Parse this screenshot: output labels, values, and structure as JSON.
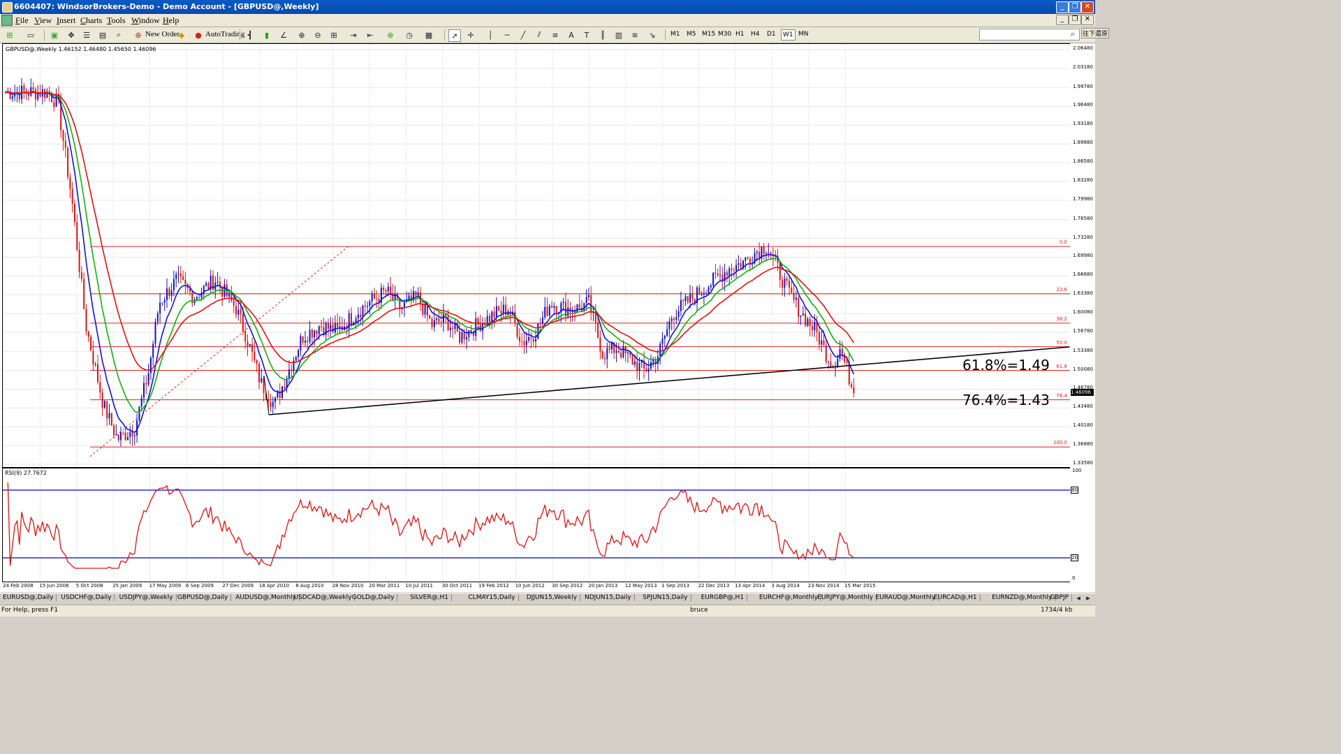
{
  "window": {
    "title": "6604407: WindsorBrokers-Demo - Demo Account - [GBPUSD@,Weekly]",
    "controls": [
      "_",
      "❐",
      "✕"
    ]
  },
  "menu": [
    "File",
    "View",
    "Insert",
    "Charts",
    "Tools",
    "Window",
    "Help"
  ],
  "toolbar": {
    "new_order": "New Order",
    "autotrading": "AutoTrading",
    "timeframes": [
      "M1",
      "M5",
      "M15",
      "M30",
      "H1",
      "H4",
      "D1",
      "W1",
      "MN"
    ],
    "active_timeframe": "W1",
    "search_button": "往下還原"
  },
  "chart": {
    "header": "GBPUSD@,Weekly  1.46152 1.46480 1.45650 1.46096",
    "current_price": "1.46096",
    "fib_labels": [
      {
        "text": "0.0",
        "price": 1.7185
      },
      {
        "text": "23.6",
        "price": 1.6355
      },
      {
        "text": "38.2",
        "price": 1.5839
      },
      {
        "text": "50.0",
        "price": 1.5425
      },
      {
        "text": "61.8",
        "price": 1.5008
      },
      {
        "text": "76.4",
        "price": 1.4492
      },
      {
        "text": "100.0",
        "price": 1.3662
      }
    ],
    "annotations": [
      "61.8%=1.49",
      "76.4%=1.43"
    ],
    "price_axis": [
      "2.06480",
      "2.03180",
      "1.99780",
      "1.96480",
      "1.93180",
      "1.89880",
      "1.86580",
      "1.83280",
      "1.79980",
      "1.76580",
      "1.73280",
      "1.69980",
      "1.66680",
      "1.63380",
      "1.60080",
      "1.56780",
      "1.53380",
      "1.50080",
      "1.46780",
      "1.43480",
      "1.40180",
      "1.36880",
      "1.33580"
    ],
    "time_axis": [
      "24 Feb 2008",
      "15 Jun 2008",
      "5 Oct 2008",
      "25 Jan 2009",
      "17 May 2009",
      "6 Sep 2009",
      "27 Dec 2009",
      "18 Apr 2010",
      "8 Aug 2010",
      "28 Nov 2010",
      "20 Mar 2011",
      "10 Jul 2011",
      "30 Oct 2011",
      "19 Feb 2012",
      "10 Jun 2012",
      "30 Sep 2012",
      "20 Jan 2013",
      "12 May 2013",
      "1 Sep 2013",
      "22 Dec 2013",
      "13 Apr 2014",
      "3 Aug 2014",
      "23 Nov 2014",
      "15 Mar 2015"
    ],
    "colors": {
      "bull": "#1010c8",
      "bear": "#e01010",
      "ma_fast": "#1010e0",
      "ma_mid": "#10b010",
      "ma_slow": "#e01010",
      "fib": "#e02020",
      "trend": "#000000"
    }
  },
  "chart_data": {
    "type": "candlestick",
    "symbol": "GBPUSD@",
    "timeframe": "Weekly",
    "last_bar": {
      "open": 1.46152,
      "high": 1.4648,
      "low": 1.4565,
      "close": 1.46096
    },
    "ylim": [
      1.3358,
      2.0648
    ],
    "approx_close_path": [
      [
        0,
        1.99
      ],
      [
        60,
        1.99
      ],
      [
        75,
        1.97
      ],
      [
        95,
        1.8
      ],
      [
        115,
        1.58
      ],
      [
        140,
        1.44
      ],
      [
        160,
        1.38
      ],
      [
        185,
        1.4
      ],
      [
        205,
        1.5
      ],
      [
        220,
        1.62
      ],
      [
        245,
        1.66
      ],
      [
        270,
        1.63
      ],
      [
        300,
        1.66
      ],
      [
        330,
        1.61
      ],
      [
        345,
        1.56
      ],
      [
        365,
        1.48
      ],
      [
        385,
        1.44
      ],
      [
        405,
        1.5
      ],
      [
        425,
        1.56
      ],
      [
        450,
        1.58
      ],
      [
        475,
        1.57
      ],
      [
        500,
        1.6
      ],
      [
        520,
        1.62
      ],
      [
        545,
        1.64
      ],
      [
        565,
        1.61
      ],
      [
        590,
        1.63
      ],
      [
        610,
        1.58
      ],
      [
        630,
        1.59
      ],
      [
        650,
        1.56
      ],
      [
        675,
        1.58
      ],
      [
        700,
        1.6
      ],
      [
        720,
        1.61
      ],
      [
        740,
        1.55
      ],
      [
        760,
        1.57
      ],
      [
        780,
        1.62
      ],
      [
        800,
        1.61
      ],
      [
        820,
        1.61
      ],
      [
        835,
        1.62
      ],
      [
        855,
        1.53
      ],
      [
        875,
        1.54
      ],
      [
        895,
        1.52
      ],
      [
        915,
        1.5
      ],
      [
        935,
        1.53
      ],
      [
        955,
        1.6
      ],
      [
        975,
        1.62
      ],
      [
        995,
        1.64
      ],
      [
        1015,
        1.66
      ],
      [
        1035,
        1.68
      ],
      [
        1055,
        1.69
      ],
      [
        1075,
        1.71
      ],
      [
        1090,
        1.72
      ],
      [
        1105,
        1.68
      ],
      [
        1120,
        1.64
      ],
      [
        1140,
        1.6
      ],
      [
        1160,
        1.57
      ],
      [
        1175,
        1.53
      ],
      [
        1185,
        1.51
      ],
      [
        1195,
        1.54
      ],
      [
        1205,
        1.5
      ],
      [
        1215,
        1.46
      ]
    ],
    "indicator": {
      "name": "RSI(9)",
      "value": "27.7672",
      "levels": [
        80,
        20
      ],
      "scale": [
        "100",
        "80",
        "20",
        "0"
      ]
    }
  },
  "symbol_tabs": [
    "EURUSD@,Daily",
    "USDCHF@,Daily",
    "USDJPY@,Weekly",
    "GBPUSD@,Daily",
    "AUDUSD@,Monthly",
    "USDCAD@,Weekly",
    "GOLD@,Daily",
    "SILVER@,H1",
    "CLMAY15,Daily",
    "DJJUN15,Weekly",
    "NDJUN15,Daily",
    "SPJUN15,Daily",
    "EURGBP@,H1",
    "EURCHF@,Monthly",
    "EURJPY@,Monthly",
    "EURAUD@,Monthly",
    "EURCAD@,H1",
    "EURNZD@,Monthly",
    "GBPJP"
  ],
  "status": {
    "help": "For Help, press F1",
    "profile": "bruce",
    "traffic": "1734/4 kb"
  }
}
